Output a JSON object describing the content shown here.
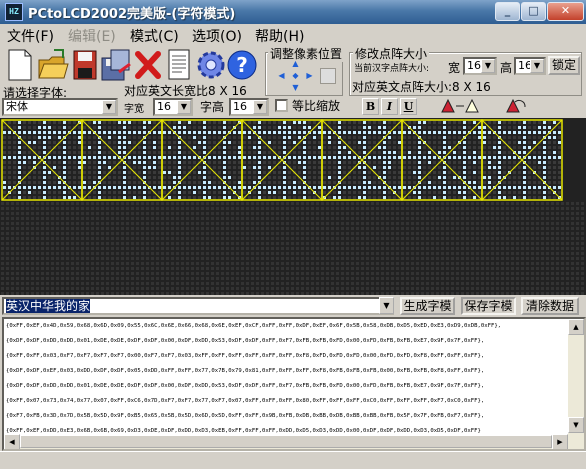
{
  "window": {
    "icon_text": "HZ",
    "title": "PCtoLCD2002完美版-(字符模式)",
    "min_label": "_",
    "max_label": "□",
    "close_label": "✕"
  },
  "menu": [
    {
      "label": "文件(F)",
      "disabled": false
    },
    {
      "label": "编辑(E)",
      "disabled": true
    },
    {
      "label": "模式(C)",
      "disabled": false
    },
    {
      "label": "选项(O)",
      "disabled": false
    },
    {
      "label": "帮助(H)",
      "disabled": false
    }
  ],
  "toolbar": {
    "icons": [
      "new-file-icon",
      "open-folder-icon",
      "save-disk-icon",
      "save-as-icon",
      "delete-icon",
      "document-icon",
      "settings-gear-icon",
      "help-icon"
    ]
  },
  "adjust": {
    "legend": "调整像素位置"
  },
  "dot_size": {
    "legend": "修改点阵大小",
    "current_label": "当前汉字点阵大小:",
    "width_label": "宽",
    "width_value": "16",
    "height_label": "高",
    "height_value": "16",
    "lock_label": "锁定",
    "english_label": "对应英文点阵大小:8 X 16"
  },
  "font": {
    "label": "请选择字体:",
    "value": "宋体",
    "en_size_label": "对应英文长宽比8 X 16",
    "char_width_label": "字宽",
    "char_width_value": "16",
    "char_height_label": "字高",
    "char_height_value": "16",
    "scale_label": "等比缩放",
    "bold_label": "B",
    "italic_label": "I",
    "underline_label": "U"
  },
  "input": {
    "text": "英汉中华我的家",
    "generate_label": "生成字模",
    "save_label": "保存字模",
    "clear_label": "清除数据"
  },
  "output_lines": [
    "{0xFF,0xEF,0x4D,0x59,0x68,0x6D,0x09,0x55,0x6C,0x6E,0x66,0x68,0x6E,0xEF,0xCF,0xFF,0xFF,0xDF,0xEF,0x6F,0x5B,0x58,0xDB,0xD5,0xED,0xE3,0xD9,0xDB,0xFF},",
    "{0xDF,0xDF,0xDD,0xDD,0x01,0xDE,0xDE,0xDF,0xDF,0x00,0xDF,0xDD,0x53,0xDF,0xDF,0xFF,0xF7,0xFB,0xFB,0xFD,0x00,0xFD,0xFB,0xFB,0xE7,0x9F,0x7F,0xFF},",
    "{0xFF,0xFF,0x03,0xF7,0xF7,0xF7,0xF7,0x00,0xF7,0xF7,0x03,0xFF,0xFF,0xFF,0xFF,0xFF,0xFF,0xF8,0xFD,0xFD,0xFD,0x00,0xFD,0xFD,0xF8,0xFF,0xFF,0xFF},",
    "{0xDF,0xDF,0xEF,0x03,0xDD,0xDF,0xDF,0x05,0xDD,0xFF,0xFF,0x77,0x7B,0x79,0x81,0xFF,0xFF,0xFF,0xF8,0xFB,0xFB,0xFB,0x00,0xFB,0xFB,0xF8,0xFF,0xFF},",
    "{0xDF,0xDF,0xDD,0xDD,0x01,0xDE,0xDE,0xDF,0xDF,0x00,0xDF,0xDD,0x53,0xDF,0xDF,0xFF,0xF7,0xFB,0xFB,0xFD,0x00,0xFD,0xFB,0xFB,0xE7,0x9F,0x7F,0xFF},",
    "{0xFF,0x07,0x73,0x74,0x77,0x07,0xFF,0xC6,0x7D,0xF7,0xF7,0x77,0xF7,0x07,0xFF,0xFF,0xFF,0x80,0xFF,0xFF,0xFF,0xC0,0xFF,0xFF,0xFF,0xF7,0xC0,0xFF},",
    "{0xF7,0xFB,0x3D,0x7D,0x5B,0x5D,0x9F,0xB5,0x65,0x5B,0x5D,0x6D,0x5D,0xFF,0xFF,0x9B,0xFB,0xDB,0xBB,0xDB,0xBB,0xBB,0xFB,0x5F,0x7F,0xFB,0xF7,0xFF},",
    "{0xFF,0xEF,0xDD,0xE3,0x6B,0x6B,0x69,0xD3,0xDE,0xDF,0xDD,0xD3,0xEB,0xFF,0xFF,0xFF,0xDD,0xD5,0xD3,0xDD,0x00,0xDF,0xDF,0xDD,0xD3,0xD5,0xDF,0xFF}"
  ],
  "colors": {
    "lcd_background": "#222222",
    "dot_on": "#c8ecff",
    "grid_line": "#e6e600",
    "selection": "#0a246a"
  }
}
